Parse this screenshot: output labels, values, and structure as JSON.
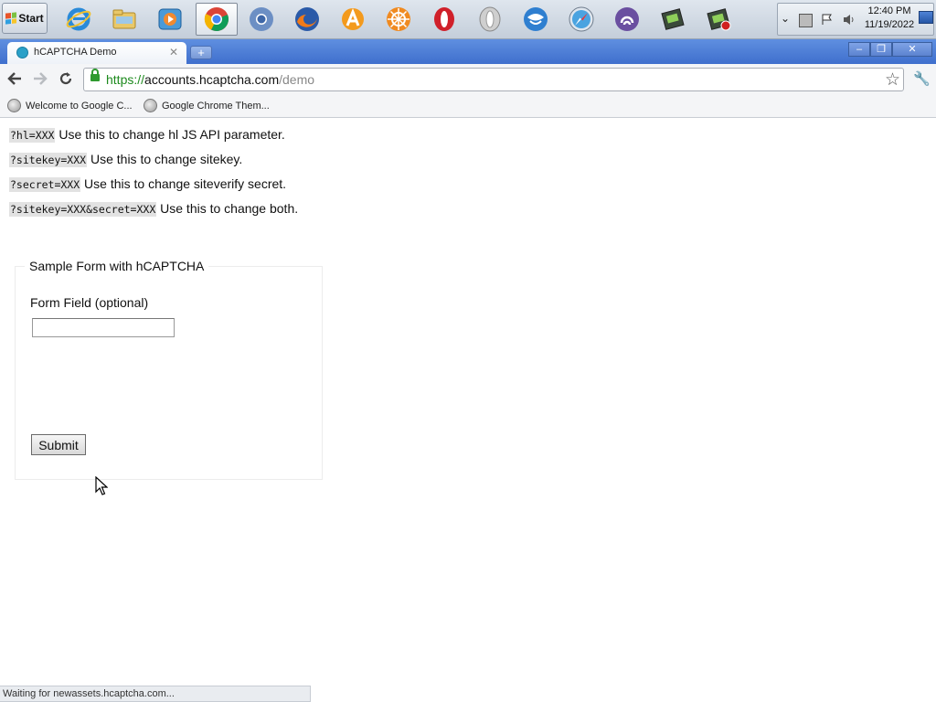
{
  "taskbar": {
    "start_label": "Start",
    "pinned_apps": [
      "internet-explorer",
      "windows-explorer",
      "media-player",
      "chrome",
      "chromium",
      "firefox",
      "avast",
      "helm",
      "opera",
      "opera-next",
      "thunderbird",
      "safari",
      "torrent",
      "gpu-tool",
      "gpu-tool-record"
    ],
    "active_app": "chrome",
    "clock_time": "12:40 PM",
    "clock_date": "11/19/2022"
  },
  "browser": {
    "tab_title": "hCAPTCHA Demo",
    "url_scheme": "https://",
    "url_host": "accounts.hcaptcha.com",
    "url_path": "/demo",
    "bookmarks": [
      {
        "label": "Welcome to Google C..."
      },
      {
        "label": "Google Chrome Them..."
      }
    ],
    "status_text": "Waiting for newassets.hcaptcha.com..."
  },
  "page": {
    "params": [
      {
        "code": "?hl=XXX",
        "text": " Use this to change hl JS API parameter."
      },
      {
        "code": "?sitekey=XXX",
        "text": " Use this to change sitekey."
      },
      {
        "code": "?secret=XXX",
        "text": " Use this to change siteverify secret."
      },
      {
        "code": "?sitekey=XXX&secret=XXX",
        "text": " Use this to change both."
      }
    ],
    "form": {
      "legend": "Sample Form with hCAPTCHA",
      "field_label": "Form Field (optional)",
      "field_value": "",
      "submit_label": "Submit"
    }
  },
  "colors": {
    "tabstrip": "#4a7bd6",
    "secure_green": "#1d8a1d",
    "code_bg": "#e2e2e2"
  }
}
